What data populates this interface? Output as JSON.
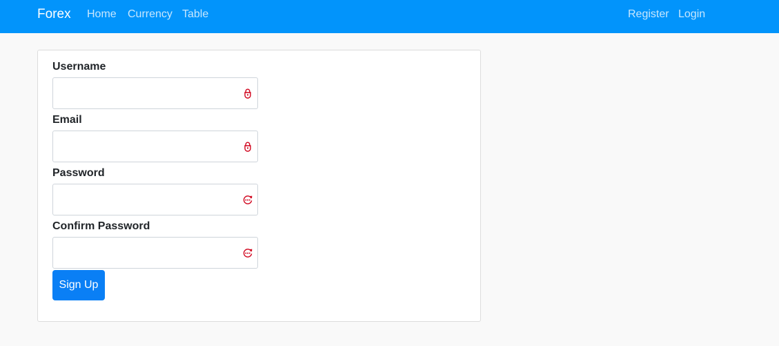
{
  "navbar": {
    "brand": "Forex",
    "links": [
      "Home",
      "Currency",
      "Table"
    ],
    "right_links": [
      "Register",
      "Login"
    ],
    "background": "#0294fb"
  },
  "form": {
    "fields": [
      {
        "label": "Username",
        "icon": "lock-icon"
      },
      {
        "label": "Email",
        "icon": "lock-icon"
      },
      {
        "label": "Password",
        "icon": "password-dots-icon"
      },
      {
        "label": "Confirm Password",
        "icon": "password-dots-icon"
      }
    ],
    "submit_label": "Sign Up",
    "accent": "#0a7ff5",
    "icon_color": "#d0021b"
  }
}
